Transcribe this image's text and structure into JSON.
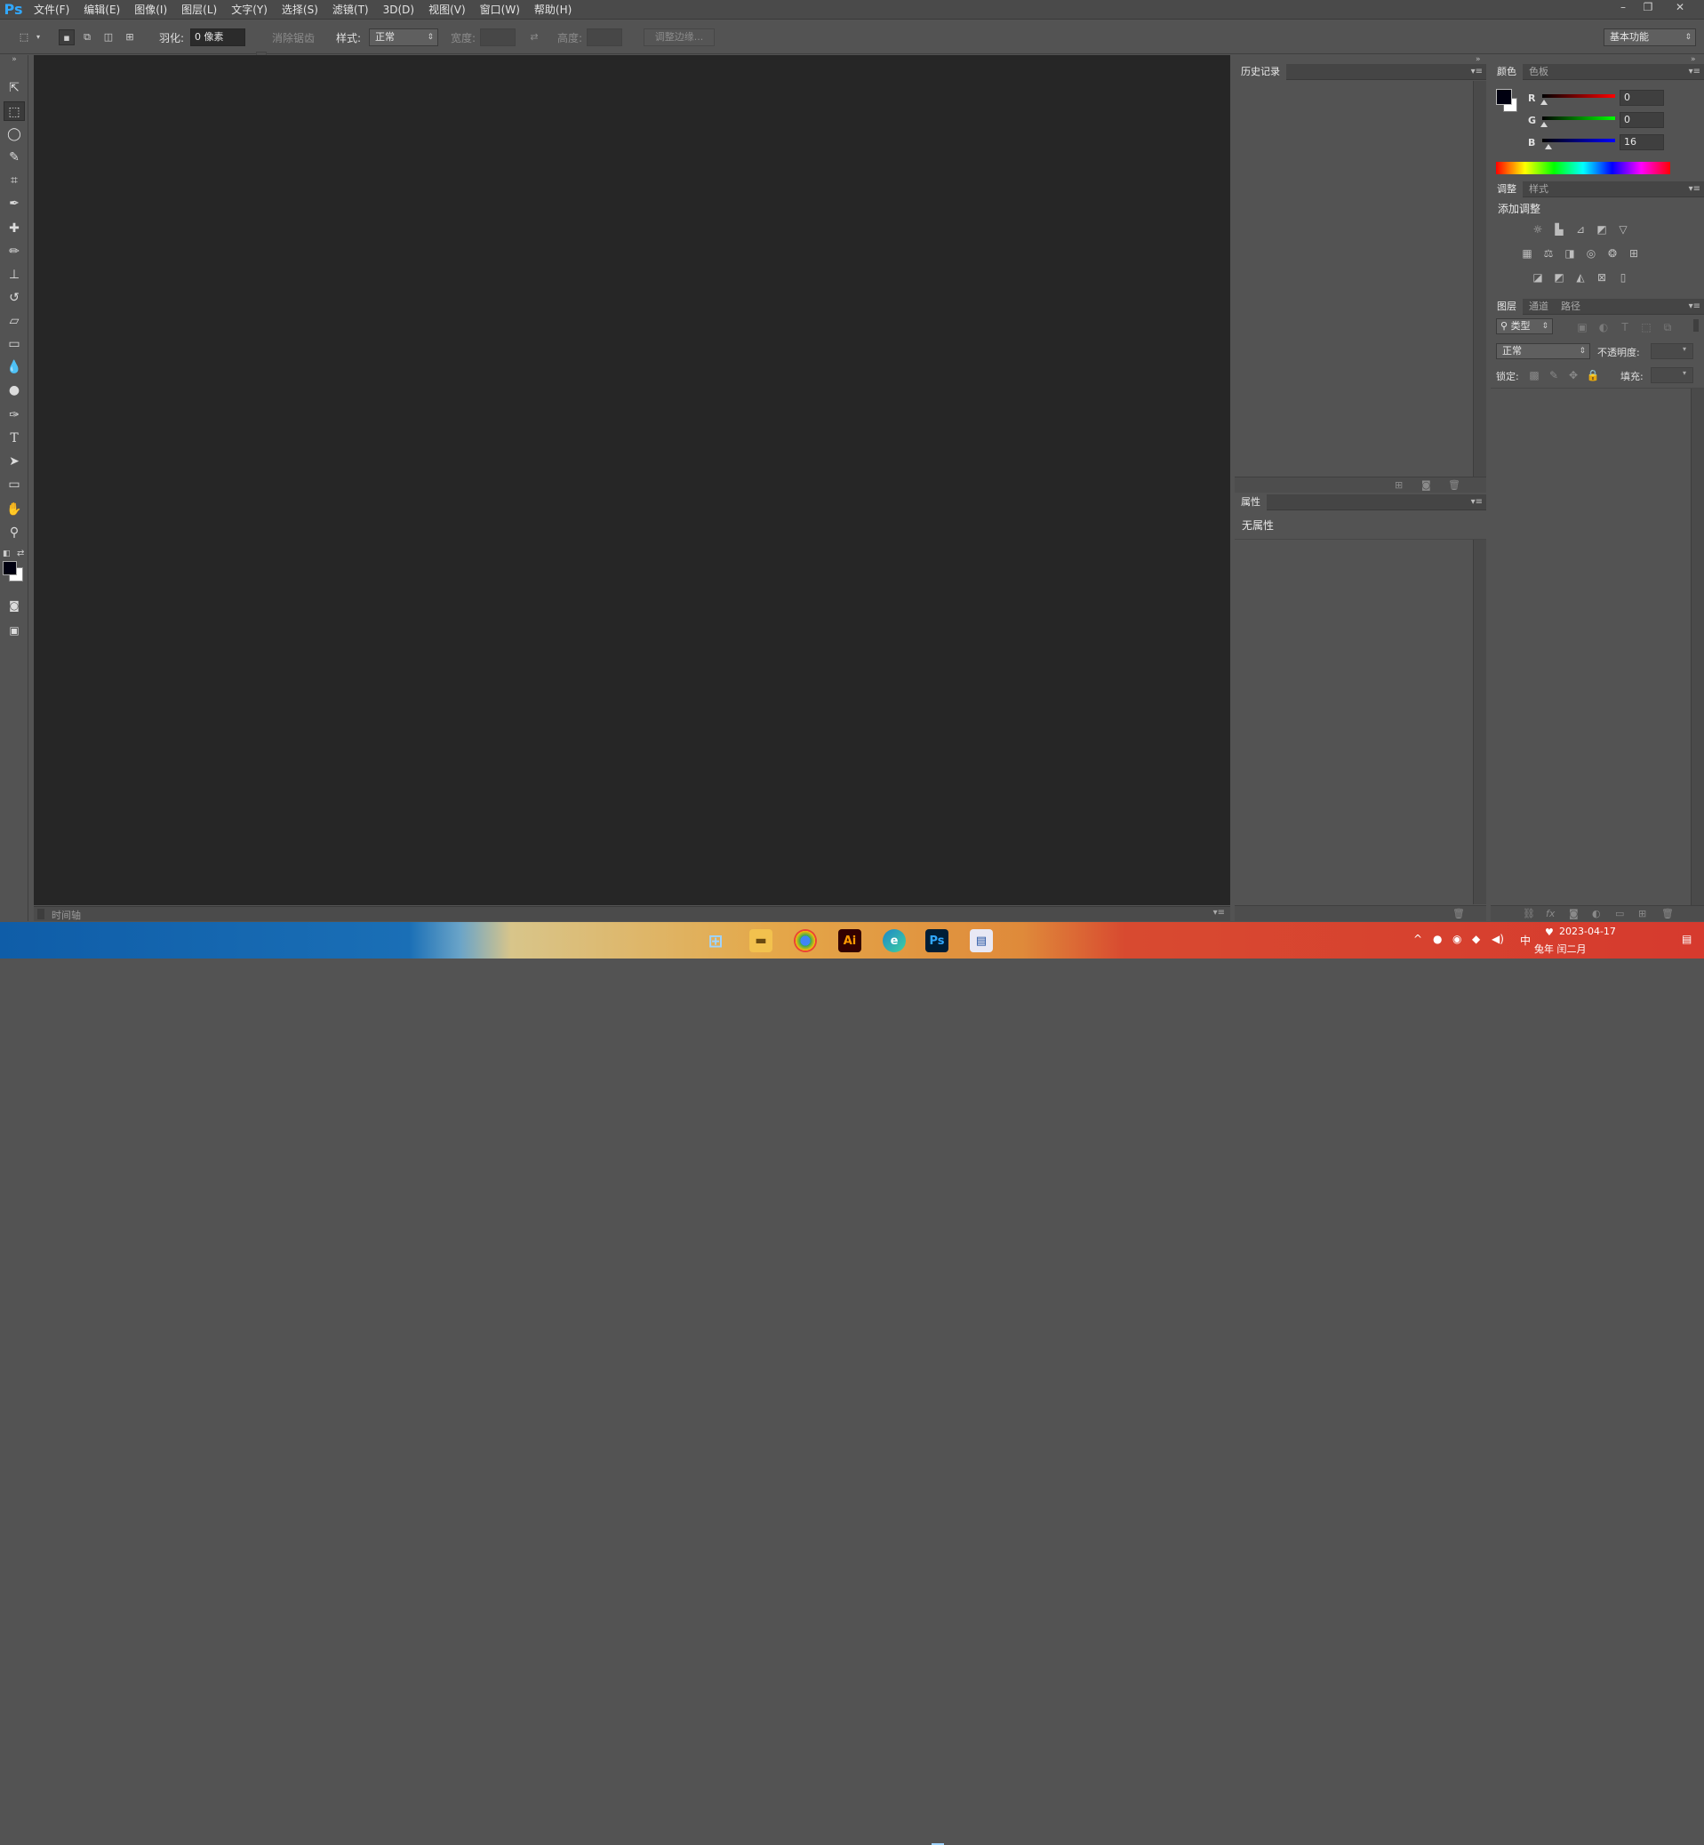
{
  "menubar": {
    "logo": "Ps",
    "items": [
      "文件(F)",
      "编辑(E)",
      "图像(I)",
      "图层(L)",
      "文字(Y)",
      "选择(S)",
      "滤镜(T)",
      "3D(D)",
      "视图(V)",
      "窗口(W)",
      "帮助(H)"
    ],
    "window_controls": [
      "–",
      "❐",
      "✕"
    ]
  },
  "options": {
    "feather_label": "羽化:",
    "feather_value": "0 像素",
    "antialias_label": "消除锯齿",
    "style_label": "样式:",
    "style_value": "正常",
    "width_label": "宽度:",
    "height_label": "高度:",
    "refine_edge": "调整边缘...",
    "workspace": "基本功能"
  },
  "timeline": {
    "label": "时间轴"
  },
  "history_panel": {
    "tab": "历史记录"
  },
  "properties_panel": {
    "tab": "属性",
    "empty_text": "无属性"
  },
  "color_panel": {
    "tabs": [
      "颜色",
      "色板"
    ],
    "channels": [
      {
        "name": "R",
        "value": "0",
        "color": "#e03030"
      },
      {
        "name": "G",
        "value": "0",
        "color": "#30c030"
      },
      {
        "name": "B",
        "value": "16",
        "color": "#3050e0"
      }
    ],
    "foreground": "#000010",
    "background": "#ffffff"
  },
  "adjustments_panel": {
    "tabs": [
      "调整",
      "样式"
    ],
    "title": "添加调整",
    "icons": [
      "brightness-icon",
      "levels-icon",
      "curves-icon",
      "exposure-icon",
      "vibrance-icon",
      "hue-saturation-icon",
      "color-balance-icon",
      "black-white-icon",
      "photo-filter-icon",
      "channel-mixer-icon",
      "color-lookup-icon",
      "invert-icon",
      "posterize-icon",
      "threshold-icon",
      "selective-color-icon",
      "gradient-map-icon"
    ]
  },
  "layers_panel": {
    "tabs": [
      "图层",
      "通道",
      "路径"
    ],
    "filter_label": "类型",
    "blend_mode": "正常",
    "opacity_label": "不透明度:",
    "lock_label": "锁定:",
    "fill_label": "填充:"
  },
  "taskbar": {
    "apps": [
      "start-icon",
      "file-explorer-icon",
      "chrome-icon",
      "illustrator-icon",
      "edge-icon",
      "photoshop-icon",
      "notepad-icon"
    ],
    "ai_label": "Ai",
    "ps_label": "Ps",
    "tray_ime": "中",
    "date": "2023-04-17",
    "lunar": "兔年 闰二月"
  }
}
